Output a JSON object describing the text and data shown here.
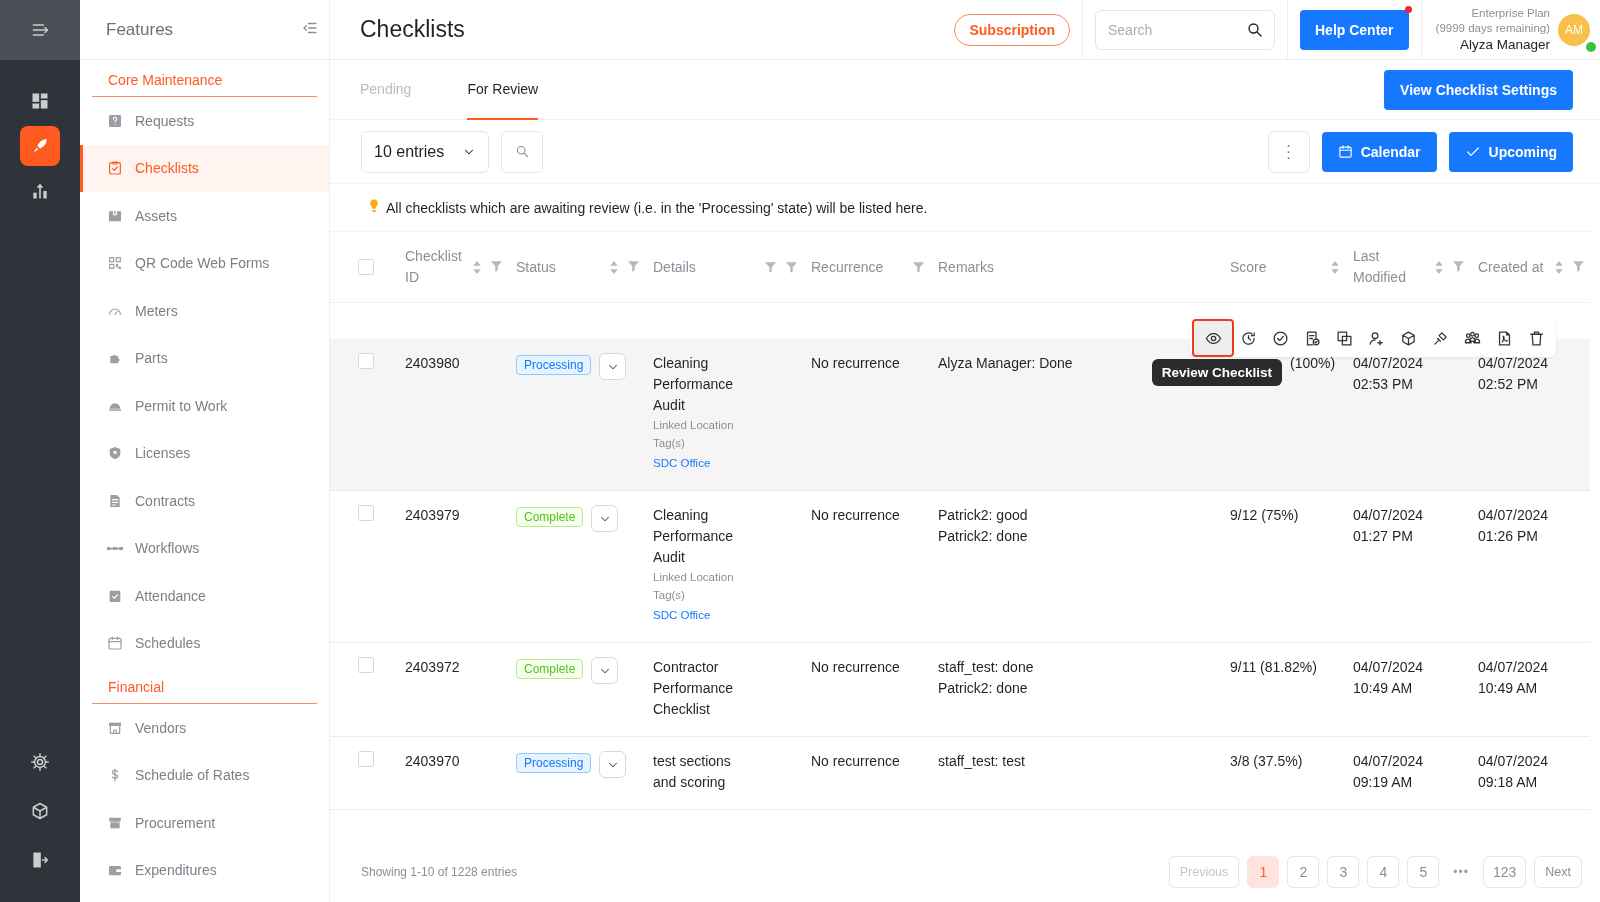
{
  "rail": {
    "top": [
      {
        "selected": false
      },
      {
        "selected": true
      },
      {
        "selected": false
      }
    ],
    "bottom": [
      {
        "selected": false
      },
      {
        "selected": false
      },
      {
        "selected": false
      }
    ]
  },
  "sidebar": {
    "title": "Features",
    "sections": [
      {
        "title": "Core Maintenance",
        "items": [
          {
            "label": "Requests",
            "selected": false
          },
          {
            "label": "Checklists",
            "selected": true
          },
          {
            "label": "Assets",
            "selected": false
          },
          {
            "label": "QR Code Web Forms",
            "selected": false
          },
          {
            "label": "Meters",
            "selected": false
          },
          {
            "label": "Parts",
            "selected": false
          },
          {
            "label": "Permit to Work",
            "selected": false
          },
          {
            "label": "Licenses",
            "selected": false
          },
          {
            "label": "Contracts",
            "selected": false
          },
          {
            "label": "Workflows",
            "selected": false
          },
          {
            "label": "Attendance",
            "selected": false
          },
          {
            "label": "Schedules",
            "selected": false
          }
        ]
      },
      {
        "title": "Financial",
        "items": [
          {
            "label": "Vendors",
            "selected": false
          },
          {
            "label": "Schedule of Rates",
            "selected": false
          },
          {
            "label": "Procurement",
            "selected": false
          },
          {
            "label": "Expenditures",
            "selected": false
          }
        ]
      }
    ]
  },
  "header": {
    "title": "Checklists",
    "subscription": "Subscription",
    "search": {
      "placeholder": "Search"
    },
    "help": {
      "label": "Help Center",
      "notification": true
    },
    "plan": "Enterprise Plan",
    "days": "(9999 days remaining)",
    "user": "Alyza Manager",
    "avatar": "AM",
    "online": true
  },
  "tabs": [
    {
      "label": "Pending",
      "selected": false
    },
    {
      "label": "For Review",
      "selected": true
    }
  ],
  "settings_button": "View Checklist Settings",
  "toolbar": {
    "entries": "10 entries",
    "calendar": "Calendar",
    "upcoming": "Upcoming"
  },
  "notice": "All checklists which are awaiting review (i.e. in the 'Processing' state) will be listed here.",
  "table": {
    "columns": [
      {
        "label": "Checklist ID",
        "sortable": true,
        "filterable": true
      },
      {
        "label": "Status",
        "sortable": true,
        "filterable": true
      },
      {
        "label": "Details",
        "filterable": true,
        "extra_filter": true
      },
      {
        "label": "Recurrence",
        "filterable": true
      },
      {
        "label": "Remarks"
      },
      {
        "label": "Score",
        "sortable": true
      },
      {
        "label": "Last Modified",
        "sortable": true,
        "filterable": true
      },
      {
        "label": "Created at",
        "sortable": true,
        "filterable": true
      }
    ],
    "select_all": {
      "checked": false
    },
    "rows": [
      {
        "id": "2403980",
        "checked": false,
        "hovered": true,
        "status": {
          "label": "Processing",
          "kind": "processing"
        },
        "details": [
          "Cleaning",
          "Performance",
          "Audit"
        ],
        "location_label": "Linked Location",
        "tags_label": "Tag(s)",
        "link": "SDC Office",
        "recurrence": "No recurrence",
        "remarks": [
          "Alyza Manager: Done"
        ],
        "score": "(100%)",
        "modified": [
          "04/07/2024",
          "02:53 PM"
        ],
        "created": [
          "04/07/2024",
          "02:52 PM"
        ]
      },
      {
        "id": "2403979",
        "checked": false,
        "hovered": false,
        "status": {
          "label": "Complete",
          "kind": "complete"
        },
        "details": [
          "Cleaning",
          "Performance",
          "Audit"
        ],
        "location_label": "Linked Location",
        "tags_label": "Tag(s)",
        "link": "SDC Office",
        "recurrence": "No recurrence",
        "remarks": [
          "Patrick2: good",
          "Patrick2: done"
        ],
        "score": "9/12 (75%)",
        "modified": [
          "04/07/2024",
          "01:27 PM"
        ],
        "created": [
          "04/07/2024",
          "01:26 PM"
        ]
      },
      {
        "id": "2403972",
        "checked": false,
        "hovered": false,
        "status": {
          "label": "Complete",
          "kind": "complete"
        },
        "details": [
          "Contractor",
          "Performance",
          "Checklist"
        ],
        "recurrence": "No recurrence",
        "remarks": [
          "staff_test: done",
          "Patrick2: done"
        ],
        "score": "9/11 (81.82%)",
        "modified": [
          "04/07/2024",
          "10:49 AM"
        ],
        "created": [
          "04/07/2024",
          "10:49 AM"
        ]
      },
      {
        "id": "2403970",
        "checked": false,
        "hovered": false,
        "status": {
          "label": "Processing",
          "kind": "processing"
        },
        "details": [
          "test sections",
          "and scoring"
        ],
        "recurrence": "No recurrence",
        "remarks": [
          "staff_test: test"
        ],
        "score": "3/8 (37.5%)",
        "modified": [
          "04/07/2024",
          "09:19 AM"
        ],
        "created": [
          "04/07/2024",
          "09:18 AM"
        ]
      }
    ],
    "row_actions": {
      "items": [
        {
          "selected": true
        },
        {
          "selected": false
        },
        {
          "selected": false
        },
        {
          "selected": false
        },
        {
          "selected": false
        },
        {
          "selected": false
        },
        {
          "selected": false
        },
        {
          "selected": false
        },
        {
          "selected": false
        },
        {
          "selected": false
        },
        {
          "selected": false
        }
      ],
      "tooltip": "Review Checklist"
    }
  },
  "footer": {
    "summary": "Showing 1-10 of 1228 entries",
    "previous": {
      "label": "Previous",
      "disabled": true
    },
    "pages": [
      {
        "label": "1",
        "selected": true
      },
      {
        "label": "2",
        "selected": false
      },
      {
        "label": "3",
        "selected": false
      },
      {
        "label": "4",
        "selected": false
      },
      {
        "label": "5",
        "selected": false
      }
    ],
    "ellipsis": "•••",
    "last": {
      "label": "123",
      "selected": false
    },
    "next": {
      "label": "Next",
      "disabled": false
    }
  }
}
